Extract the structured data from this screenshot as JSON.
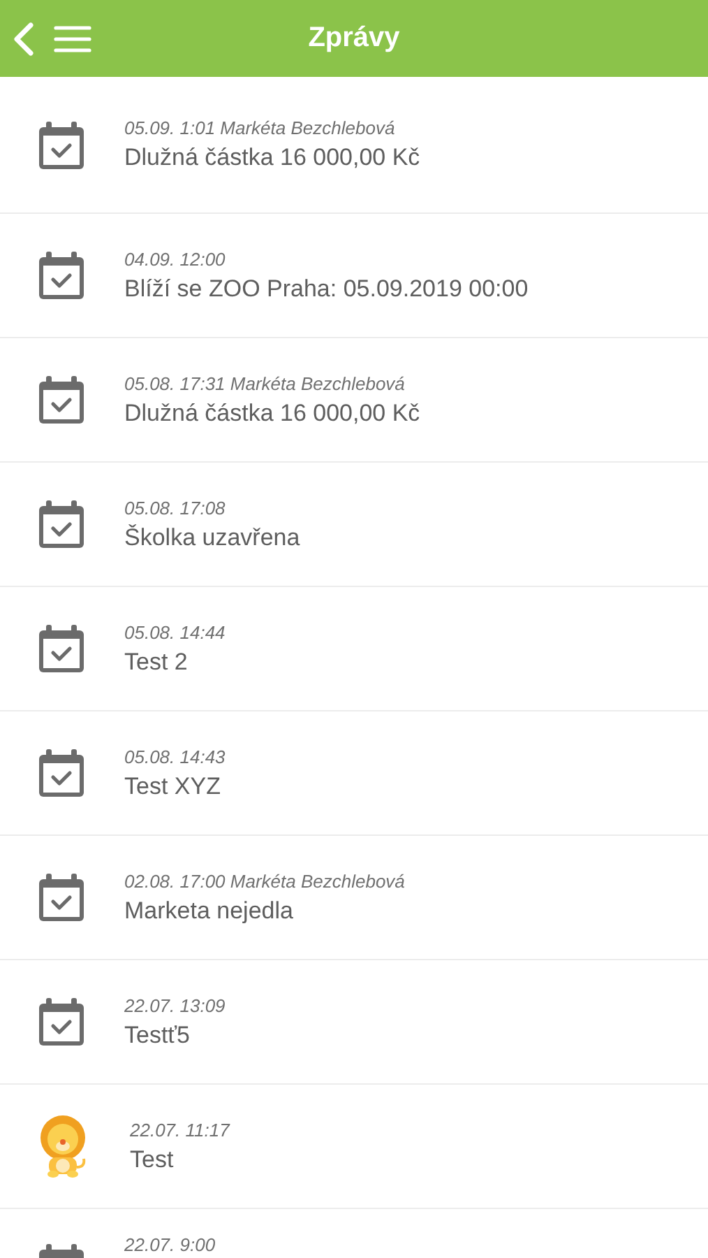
{
  "header": {
    "title": "Zprávy"
  },
  "messages": [
    {
      "kind": "calendar",
      "meta": "05.09. 1:01 Markéta Bezchlebová",
      "title": "Dlužná částka 16 000,00 Kč"
    },
    {
      "kind": "calendar",
      "meta": "04.09. 12:00",
      "title": "Blíží se ZOO Praha: 05.09.2019 00:00"
    },
    {
      "kind": "calendar",
      "meta": "05.08. 17:31 Markéta Bezchlebová",
      "title": "Dlužná částka 16 000,00 Kč"
    },
    {
      "kind": "calendar",
      "meta": "05.08. 17:08",
      "title": "Školka uzavřena"
    },
    {
      "kind": "calendar",
      "meta": "05.08. 14:44",
      "title": "Test 2"
    },
    {
      "kind": "calendar",
      "meta": "05.08. 14:43",
      "title": "Test XYZ"
    },
    {
      "kind": "calendar",
      "meta": "02.08. 17:00 Markéta Bezchlebová",
      "title": "Marketa nejedla"
    },
    {
      "kind": "calendar",
      "meta": "22.07. 13:09",
      "title": "Testť5"
    },
    {
      "kind": "lion",
      "meta": "22.07. 11:17",
      "title": "Test"
    },
    {
      "kind": "calendar",
      "meta": "22.07. 9:00"
    }
  ]
}
